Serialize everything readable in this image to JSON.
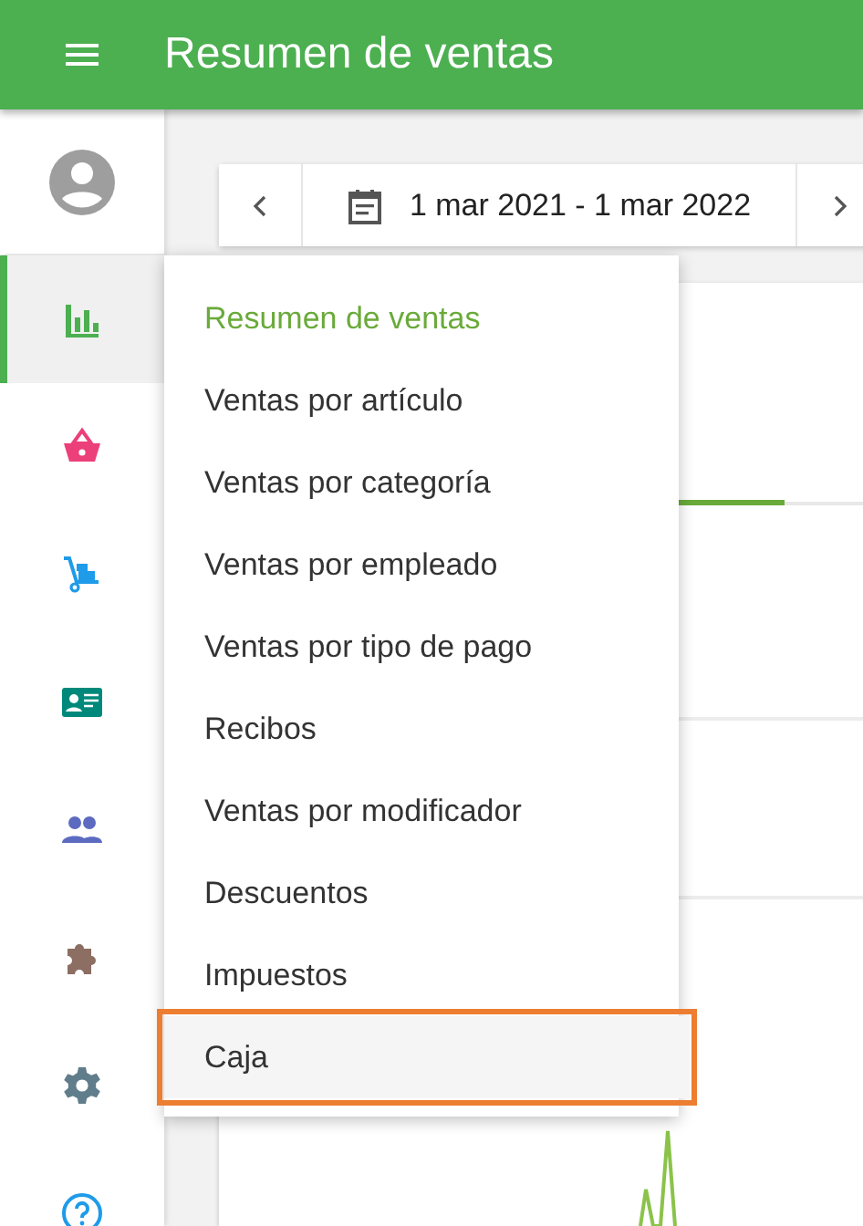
{
  "header": {
    "title": "Resumen de ventas"
  },
  "sidebar": {
    "items": [
      {
        "kind": "avatar",
        "selected": false
      },
      {
        "kind": "reports",
        "selected": true
      },
      {
        "kind": "items",
        "selected": false
      },
      {
        "kind": "inventory",
        "selected": false
      },
      {
        "kind": "customers",
        "selected": false
      },
      {
        "kind": "employees",
        "selected": false
      },
      {
        "kind": "integrations",
        "selected": false
      },
      {
        "kind": "settings",
        "selected": false
      },
      {
        "kind": "help",
        "selected": false
      }
    ]
  },
  "date_range": {
    "label": "1 mar 2021 - 1 mar 2022"
  },
  "menu": {
    "items": [
      {
        "label": "Resumen de ventas",
        "selected": true,
        "highlighted": false
      },
      {
        "label": "Ventas por artículo",
        "selected": false,
        "highlighted": false
      },
      {
        "label": "Ventas por categoría",
        "selected": false,
        "highlighted": false
      },
      {
        "label": "Ventas por empleado",
        "selected": false,
        "highlighted": false
      },
      {
        "label": "Ventas por tipo de pago",
        "selected": false,
        "highlighted": false
      },
      {
        "label": "Recibos",
        "selected": false,
        "highlighted": false
      },
      {
        "label": "Ventas por modificador",
        "selected": false,
        "highlighted": false
      },
      {
        "label": "Descuentos",
        "selected": false,
        "highlighted": false
      },
      {
        "label": "Impuestos",
        "selected": false,
        "highlighted": false
      },
      {
        "label": "Caja",
        "selected": false,
        "highlighted": true
      }
    ]
  }
}
